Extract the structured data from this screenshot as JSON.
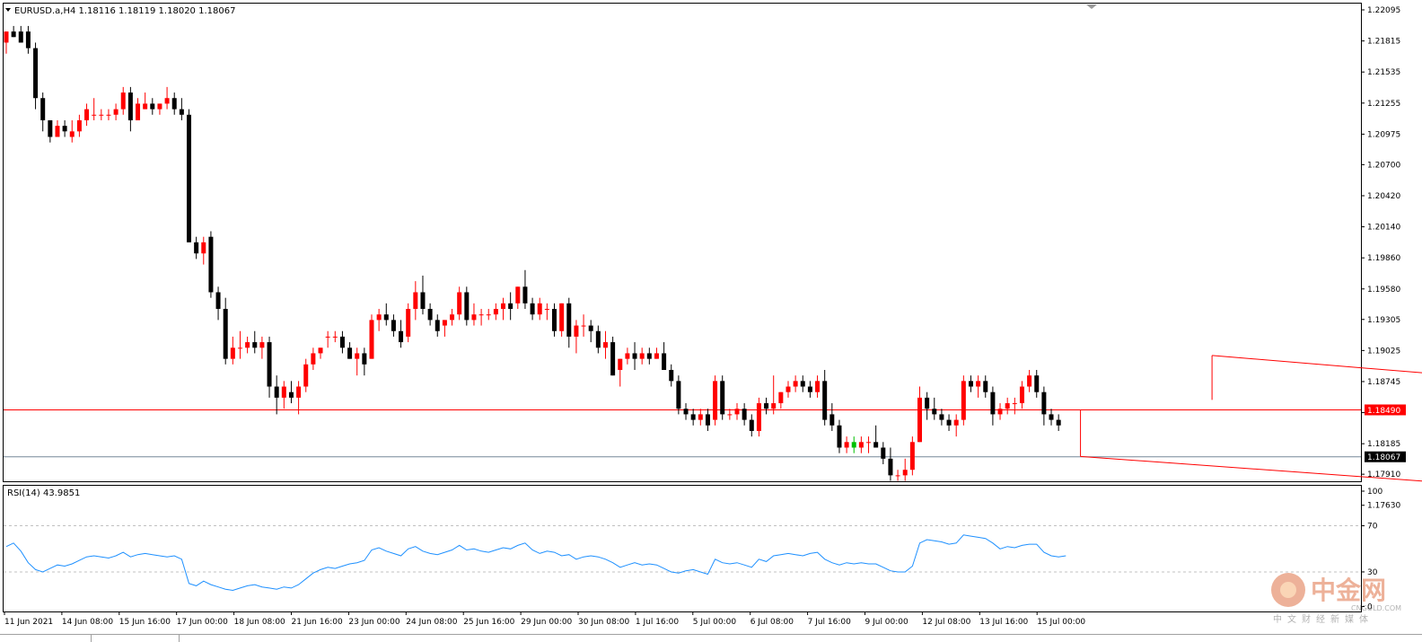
{
  "chart_title": "EURUSD.a,H4  1.18116 1.18119 1.18020 1.18067",
  "rsi_label": "RSI(14) 43.9851",
  "watermark": {
    "brand": "中金网",
    "url": "CNGOLD.COM",
    "slogan": "中文财经新媒体"
  },
  "colors": {
    "bull": "#ff0000",
    "bear": "#000000",
    "last_bull": "#00c000",
    "channel": "#ff0000",
    "hline": "#ff0000",
    "bid_line": "#778899",
    "rsi": "#1e90ff",
    "rsi_levels": "#c0c0c0",
    "tag_red": "#ff0000",
    "tag_black": "#000000"
  },
  "chart_data": [
    {
      "type": "candlestick",
      "symbol": "EURUSD.a",
      "timeframe": "H4",
      "ohlc_last": {
        "open": 1.18116,
        "high": 1.18119,
        "low": 1.1802,
        "close": 1.18067
      },
      "y_ticks": [
        1.22095,
        1.21815,
        1.21535,
        1.21255,
        1.20975,
        1.207,
        1.2042,
        1.2014,
        1.1986,
        1.1958,
        1.19305,
        1.19025,
        1.18745,
        1.18465,
        1.18185,
        1.1791,
        1.1763
      ],
      "ylim": [
        1.176,
        1.2212
      ],
      "x_tick_labels": [
        "11 Jun 2021",
        "14 Jun 08:00",
        "15 Jun 16:00",
        "17 Jun 00:00",
        "18 Jun 08:00",
        "21 Jun 16:00",
        "23 Jun 00:00",
        "24 Jun 08:00",
        "25 Jun 16:00",
        "29 Jun 00:00",
        "30 Jun 08:00",
        "1 Jul 16:00",
        "5 Jul 00:00",
        "6 Jul 08:00",
        "7 Jul 16:00",
        "9 Jul 00:00",
        "12 Jul 08:00",
        "13 Jul 16:00",
        "15 Jul 00:00"
      ],
      "horizontal_line": {
        "price": 1.1849,
        "label": "1.18490"
      },
      "bid_line": {
        "price": 1.18067,
        "label": "1.18067"
      },
      "channel": {
        "upper": {
          "from_index": 165,
          "from_price": 1.1898,
          "to_index": 248,
          "to_price": 1.1853
        },
        "lower": {
          "from_index": 147,
          "from_price": 1.1807,
          "to_index": 240,
          "to_price": 1.1763
        }
      },
      "candles_ohlc": [
        [
          1.218,
          1.219,
          1.217,
          1.219
        ],
        [
          1.219,
          1.2195,
          1.2185,
          1.2185
        ],
        [
          1.219,
          1.2195,
          1.218,
          1.218
        ],
        [
          1.219,
          1.2195,
          1.217,
          1.2175
        ],
        [
          1.2175,
          1.218,
          1.212,
          1.213
        ],
        [
          1.213,
          1.2135,
          1.21,
          1.211
        ],
        [
          1.211,
          1.211,
          1.209,
          1.2095
        ],
        [
          1.2095,
          1.211,
          1.2095,
          1.2105
        ],
        [
          1.2105,
          1.211,
          1.2095,
          1.21
        ],
        [
          1.2095,
          1.211,
          1.209,
          1.21
        ],
        [
          1.21,
          1.2115,
          1.2095,
          1.211
        ],
        [
          1.211,
          1.2125,
          1.2105,
          1.212
        ],
        [
          1.2115,
          1.213,
          1.211,
          1.2115
        ],
        [
          1.2115,
          1.212,
          1.211,
          1.2115
        ],
        [
          1.2115,
          1.212,
          1.211,
          1.2115
        ],
        [
          1.2115,
          1.2125,
          1.211,
          1.212
        ],
        [
          1.212,
          1.214,
          1.2115,
          1.2135
        ],
        [
          1.2135,
          1.214,
          1.21,
          1.211
        ],
        [
          1.211,
          1.213,
          1.211,
          1.2125
        ],
        [
          1.212,
          1.2135,
          1.212,
          1.2125
        ],
        [
          1.2125,
          1.213,
          1.2115,
          1.212
        ],
        [
          1.212,
          1.2125,
          1.2115,
          1.2125
        ],
        [
          1.2125,
          1.214,
          1.212,
          1.213
        ],
        [
          1.213,
          1.2135,
          1.2115,
          1.212
        ],
        [
          1.212,
          1.213,
          1.211,
          1.2115
        ],
        [
          1.2115,
          1.212,
          1.2,
          1.2
        ],
        [
          1.2,
          1.2005,
          1.1985,
          1.199
        ],
        [
          1.199,
          1.2005,
          1.198,
          1.2
        ],
        [
          1.2005,
          1.201,
          1.195,
          1.1955
        ],
        [
          1.1955,
          1.196,
          1.193,
          1.194
        ],
        [
          1.194,
          1.195,
          1.189,
          1.1895
        ],
        [
          1.1895,
          1.1915,
          1.189,
          1.1905
        ],
        [
          1.1905,
          1.192,
          1.1895,
          1.1905
        ],
        [
          1.1905,
          1.1915,
          1.19,
          1.191
        ],
        [
          1.191,
          1.192,
          1.19,
          1.1905
        ],
        [
          1.1905,
          1.1915,
          1.1895,
          1.191
        ],
        [
          1.191,
          1.1915,
          1.186,
          1.187
        ],
        [
          1.187,
          1.188,
          1.1845,
          1.186
        ],
        [
          1.186,
          1.1875,
          1.185,
          1.187
        ],
        [
          1.1865,
          1.1875,
          1.1855,
          1.186
        ],
        [
          1.186,
          1.1875,
          1.1845,
          1.187
        ],
        [
          1.187,
          1.1895,
          1.1865,
          1.189
        ],
        [
          1.189,
          1.1905,
          1.1885,
          1.19
        ],
        [
          1.19,
          1.1905,
          1.1895,
          1.1905
        ],
        [
          1.1915,
          1.192,
          1.1905,
          1.1915
        ],
        [
          1.1915,
          1.192,
          1.191,
          1.1915
        ],
        [
          1.1915,
          1.192,
          1.19,
          1.1905
        ],
        [
          1.1905,
          1.191,
          1.1895,
          1.1895
        ],
        [
          1.1895,
          1.1905,
          1.188,
          1.19
        ],
        [
          1.19,
          1.1905,
          1.188,
          1.189
        ],
        [
          1.1895,
          1.1935,
          1.1895,
          1.193
        ],
        [
          1.193,
          1.194,
          1.192,
          1.1935
        ],
        [
          1.1935,
          1.1945,
          1.1925,
          1.193
        ],
        [
          1.193,
          1.1935,
          1.1915,
          1.192
        ],
        [
          1.192,
          1.193,
          1.1905,
          1.191
        ],
        [
          1.1915,
          1.1945,
          1.191,
          1.194
        ],
        [
          1.194,
          1.1965,
          1.193,
          1.1955
        ],
        [
          1.1955,
          1.197,
          1.1935,
          1.194
        ],
        [
          1.194,
          1.1945,
          1.1925,
          1.193
        ],
        [
          1.193,
          1.1935,
          1.1915,
          1.192
        ],
        [
          1.1925,
          1.193,
          1.1915,
          1.193
        ],
        [
          1.193,
          1.194,
          1.1925,
          1.1935
        ],
        [
          1.1935,
          1.196,
          1.193,
          1.1955
        ],
        [
          1.1955,
          1.196,
          1.1925,
          1.193
        ],
        [
          1.193,
          1.1945,
          1.1925,
          1.1935
        ],
        [
          1.1935,
          1.194,
          1.1925,
          1.1935
        ],
        [
          1.1935,
          1.194,
          1.193,
          1.1935
        ],
        [
          1.1935,
          1.1945,
          1.193,
          1.194
        ],
        [
          1.194,
          1.195,
          1.193,
          1.1945
        ],
        [
          1.1945,
          1.1955,
          1.193,
          1.194
        ],
        [
          1.1945,
          1.196,
          1.194,
          1.196
        ],
        [
          1.196,
          1.1975,
          1.194,
          1.1945
        ],
        [
          1.1945,
          1.195,
          1.193,
          1.1935
        ],
        [
          1.1935,
          1.195,
          1.193,
          1.1945
        ],
        [
          1.194,
          1.1945,
          1.193,
          1.194
        ],
        [
          1.194,
          1.1945,
          1.1915,
          1.192
        ],
        [
          1.192,
          1.1945,
          1.1915,
          1.1945
        ],
        [
          1.1945,
          1.195,
          1.1905,
          1.1915
        ],
        [
          1.1915,
          1.193,
          1.19,
          1.1925
        ],
        [
          1.1925,
          1.1935,
          1.1915,
          1.1925
        ],
        [
          1.1925,
          1.193,
          1.191,
          1.192
        ],
        [
          1.192,
          1.1925,
          1.19,
          1.1905
        ],
        [
          1.1905,
          1.192,
          1.1895,
          1.191
        ],
        [
          1.191,
          1.1915,
          1.188,
          1.188
        ],
        [
          1.1885,
          1.1895,
          1.187,
          1.1895
        ],
        [
          1.1895,
          1.1905,
          1.189,
          1.19
        ],
        [
          1.19,
          1.191,
          1.1885,
          1.1895
        ],
        [
          1.1895,
          1.1905,
          1.189,
          1.19
        ],
        [
          1.19,
          1.1905,
          1.189,
          1.1895
        ],
        [
          1.1895,
          1.1905,
          1.1895,
          1.19
        ],
        [
          1.19,
          1.191,
          1.1885,
          1.1885
        ],
        [
          1.1885,
          1.189,
          1.187,
          1.1875
        ],
        [
          1.1875,
          1.188,
          1.1845,
          1.185
        ],
        [
          1.185,
          1.1855,
          1.184,
          1.1845
        ],
        [
          1.1845,
          1.185,
          1.1835,
          1.184
        ],
        [
          1.184,
          1.185,
          1.1835,
          1.1845
        ],
        [
          1.1845,
          1.185,
          1.183,
          1.1835
        ],
        [
          1.184,
          1.188,
          1.1835,
          1.1875
        ],
        [
          1.1875,
          1.188,
          1.184,
          1.1845
        ],
        [
          1.1845,
          1.185,
          1.184,
          1.1845
        ],
        [
          1.1845,
          1.1855,
          1.184,
          1.185
        ],
        [
          1.185,
          1.1855,
          1.1835,
          1.184
        ],
        [
          1.184,
          1.1845,
          1.1825,
          1.183
        ],
        [
          1.183,
          1.186,
          1.1825,
          1.1855
        ],
        [
          1.1855,
          1.186,
          1.1845,
          1.185
        ],
        [
          1.185,
          1.188,
          1.1845,
          1.1855
        ],
        [
          1.1855,
          1.1865,
          1.185,
          1.1865
        ],
        [
          1.1865,
          1.1875,
          1.186,
          1.187
        ],
        [
          1.187,
          1.188,
          1.1865,
          1.1875
        ],
        [
          1.1875,
          1.188,
          1.1865,
          1.187
        ],
        [
          1.187,
          1.1875,
          1.186,
          1.1865
        ],
        [
          1.1865,
          1.188,
          1.186,
          1.1875
        ],
        [
          1.1875,
          1.1885,
          1.1835,
          1.184
        ],
        [
          1.1845,
          1.1855,
          1.183,
          1.1835
        ],
        [
          1.1835,
          1.184,
          1.181,
          1.1815
        ],
        [
          1.1815,
          1.1825,
          1.181,
          1.182
        ],
        [
          1.182,
          1.1825,
          1.181,
          1.1815
        ],
        [
          1.1815,
          1.1825,
          1.181,
          1.182
        ],
        [
          1.182,
          1.1825,
          1.181,
          1.182
        ],
        [
          1.182,
          1.1835,
          1.1815,
          1.1815
        ],
        [
          1.1815,
          1.182,
          1.18,
          1.1805
        ],
        [
          1.1805,
          1.1815,
          1.1785,
          1.179
        ],
        [
          1.179,
          1.1795,
          1.1785,
          1.179
        ],
        [
          1.179,
          1.1805,
          1.1785,
          1.1795
        ],
        [
          1.1795,
          1.1825,
          1.179,
          1.182
        ],
        [
          1.182,
          1.187,
          1.182,
          1.186
        ],
        [
          1.186,
          1.1865,
          1.184,
          1.185
        ],
        [
          1.185,
          1.186,
          1.184,
          1.1845
        ],
        [
          1.1845,
          1.185,
          1.1835,
          1.184
        ],
        [
          1.184,
          1.1845,
          1.183,
          1.1835
        ],
        [
          1.1835,
          1.1845,
          1.1825,
          1.184
        ],
        [
          1.184,
          1.188,
          1.1835,
          1.1875
        ],
        [
          1.1875,
          1.188,
          1.1865,
          1.187
        ],
        [
          1.187,
          1.188,
          1.186,
          1.1875
        ],
        [
          1.1875,
          1.188,
          1.186,
          1.1865
        ],
        [
          1.1865,
          1.187,
          1.1835,
          1.1845
        ],
        [
          1.1845,
          1.1855,
          1.184,
          1.185
        ],
        [
          1.185,
          1.186,
          1.1845,
          1.1855
        ],
        [
          1.1855,
          1.186,
          1.1845,
          1.1855
        ],
        [
          1.1855,
          1.1875,
          1.185,
          1.187
        ],
        [
          1.187,
          1.1885,
          1.1865,
          1.188
        ],
        [
          1.188,
          1.1885,
          1.186,
          1.1865
        ],
        [
          1.1865,
          1.187,
          1.1835,
          1.1845
        ],
        [
          1.1845,
          1.185,
          1.1835,
          1.184
        ],
        [
          1.184,
          1.1845,
          1.183,
          1.1835
        ]
      ]
    },
    {
      "type": "line",
      "name": "RSI(14)",
      "value_last": 43.9851,
      "levels": [
        70,
        30
      ],
      "y_ticks": [
        100,
        70,
        30,
        0
      ],
      "ylim": [
        0,
        100
      ],
      "values": [
        52,
        55,
        48,
        38,
        32,
        30,
        33,
        36,
        35,
        37,
        40,
        43,
        44,
        43,
        42,
        44,
        47,
        43,
        45,
        46,
        45,
        44,
        43,
        44,
        41,
        20,
        18,
        22,
        19,
        17,
        15,
        14,
        16,
        18,
        19,
        17,
        16,
        15,
        17,
        16,
        19,
        24,
        29,
        32,
        34,
        33,
        35,
        37,
        38,
        40,
        49,
        51,
        48,
        46,
        44,
        50,
        52,
        48,
        46,
        45,
        47,
        49,
        53,
        49,
        50,
        48,
        47,
        49,
        51,
        50,
        53,
        55,
        49,
        46,
        48,
        47,
        44,
        45,
        41,
        43,
        44,
        43,
        41,
        38,
        34,
        36,
        38,
        36,
        37,
        36,
        33,
        30,
        29,
        31,
        32,
        30,
        28,
        41,
        38,
        37,
        38,
        36,
        34,
        41,
        39,
        44,
        45,
        46,
        45,
        44,
        46,
        47,
        41,
        38,
        36,
        38,
        37,
        38,
        37,
        37,
        34,
        31,
        30,
        30,
        35,
        55,
        58,
        57,
        56,
        54,
        55,
        62,
        61,
        60,
        59,
        55,
        50,
        52,
        51,
        53,
        54,
        54,
        47,
        44,
        43,
        44
      ]
    }
  ]
}
